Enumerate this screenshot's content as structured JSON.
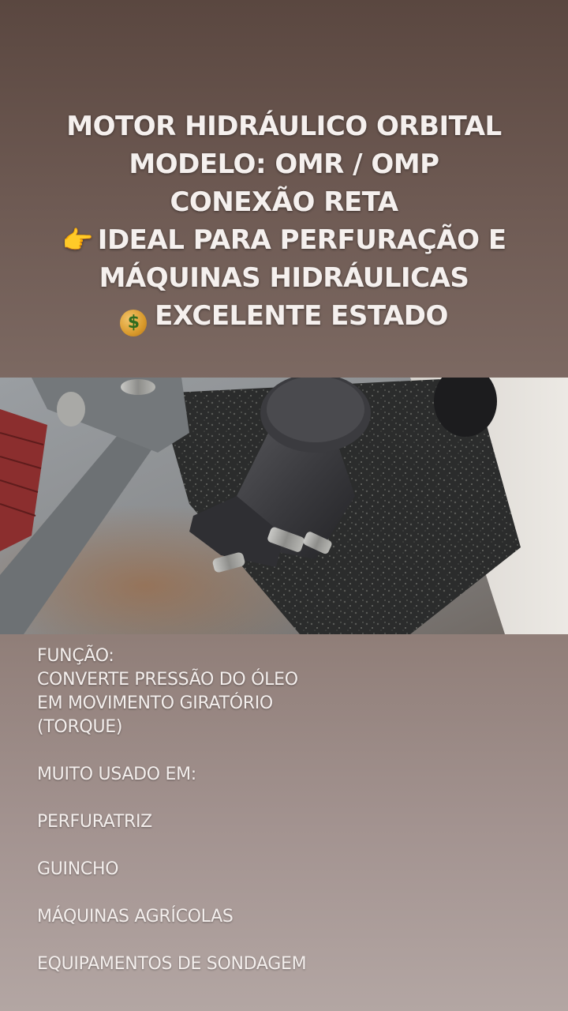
{
  "headline": {
    "line1": "MOTOR HIDRÁULICO ORBITAL",
    "line2": "MODELO: OMR / OMP",
    "line3": "CONEXÃO RETA",
    "line4_emoji": "👉",
    "line4": "IDEAL PARA PERFURAÇÃO E",
    "line5": "MÁQUINAS HIDRÁULICAS",
    "line6_emoji": "$",
    "line6": "EXCELENTE ESTADO"
  },
  "info": {
    "funcao_label": "FUNÇÃO:",
    "funcao_line1": "CONVERTE PRESSÃO DO ÓLEO",
    "funcao_line2": "EM MOVIMENTO GIRATÓRIO",
    "funcao_line3": "(TORQUE)",
    "uses_label": "MUITO USADO EM:",
    "uses": [
      "PERFURATRIZ",
      "GUINCHO",
      "MÁQUINAS AGRÍCOLAS",
      "EQUIPAMENTOS DE SONDAGEM"
    ]
  },
  "colors": {
    "background_top": "#5a4740",
    "background_bottom": "#b3a6a3",
    "text": "#f5f0ee"
  },
  "icons": [
    "pointing-hand-emoji",
    "money-bag-emoji"
  ]
}
